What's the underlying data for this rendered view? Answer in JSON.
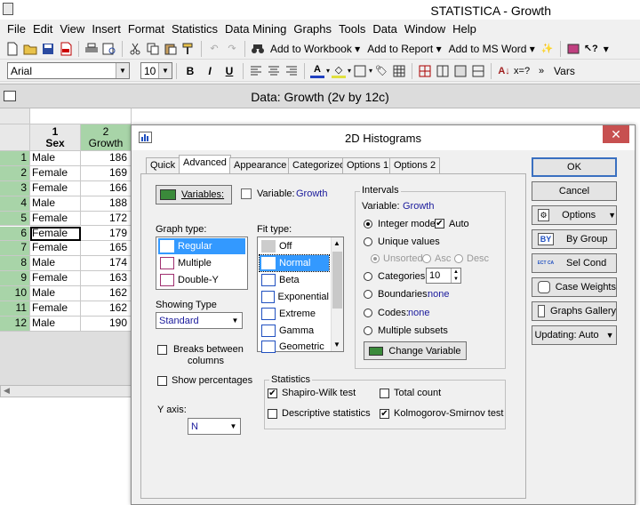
{
  "app": {
    "title": "STATISTICA - Growth"
  },
  "menu": [
    "File",
    "Edit",
    "View",
    "Insert",
    "Format",
    "Statistics",
    "Data Mining",
    "Graphs",
    "Tools",
    "Data",
    "Window",
    "Help"
  ],
  "toolbar1": {
    "add_workbook": "Add to Workbook",
    "add_report": "Add to Report",
    "add_msword": "Add to MS Word"
  },
  "toolbar2": {
    "font": "Arial",
    "size": "10",
    "bold": "B",
    "italic": "I",
    "underline": "U",
    "vars": "Vars"
  },
  "data_window": {
    "title": "Data: Growth (2v by 12c)"
  },
  "sheet": {
    "columns": [
      {
        "num": "1",
        "name": "Sex"
      },
      {
        "num": "2",
        "name": "Growth"
      }
    ],
    "rows": [
      {
        "n": "1",
        "sex": "Male",
        "growth": "186"
      },
      {
        "n": "2",
        "sex": "Female",
        "growth": "169"
      },
      {
        "n": "3",
        "sex": "Female",
        "growth": "166"
      },
      {
        "n": "4",
        "sex": "Male",
        "growth": "188"
      },
      {
        "n": "5",
        "sex": "Female",
        "growth": "172"
      },
      {
        "n": "6",
        "sex": "Female",
        "growth": "179"
      },
      {
        "n": "7",
        "sex": "Female",
        "growth": "165"
      },
      {
        "n": "8",
        "sex": "Male",
        "growth": "174"
      },
      {
        "n": "9",
        "sex": "Female",
        "growth": "163"
      },
      {
        "n": "10",
        "sex": "Male",
        "growth": "162"
      },
      {
        "n": "11",
        "sex": "Female",
        "growth": "162"
      },
      {
        "n": "12",
        "sex": "Male",
        "growth": "190"
      }
    ]
  },
  "dialog": {
    "title": "2D Histograms",
    "close": "✕",
    "tabs": [
      "Quick",
      "Advanced",
      "Appearance",
      "Categorized",
      "Options 1",
      "Options 2"
    ],
    "variables_button": "Variables:",
    "variable_label": "Variable:",
    "variable_value": "Growth",
    "graph_type_label": "Graph type:",
    "graph_types": [
      "Regular",
      "Multiple",
      "Double-Y"
    ],
    "fit_type_label": "Fit type:",
    "fit_types": [
      "Off",
      "Normal",
      "Beta",
      "Exponential",
      "Extreme",
      "Gamma",
      "Geometric"
    ],
    "showing_type_label": "Showing Type",
    "showing_type_value": "Standard",
    "breaks_label_1": "Breaks between",
    "breaks_label_2": "columns",
    "show_percentages": "Show percentages",
    "y_axis_label": "Y axis:",
    "y_axis_value": "N",
    "intervals": {
      "title": "Intervals",
      "variable_label": "Variable:",
      "variable_value": "Growth",
      "integer_mode": "Integer mode",
      "auto": "Auto",
      "unique_values": "Unique values",
      "unsorted": "Unsorted",
      "asc": "Asc",
      "desc": "Desc",
      "categories": "Categories:",
      "categories_value": "10",
      "boundaries": "Boundaries:",
      "boundaries_value": "none",
      "codes": "Codes:",
      "codes_value": "none",
      "multiple_subsets": "Multiple subsets",
      "change_variable": "Change Variable"
    },
    "statistics": {
      "title": "Statistics",
      "shapiro": "Shapiro-Wilk test",
      "total_count": "Total count",
      "descriptive": "Descriptive statistics",
      "kolmogorov": "Kolmogorov-Smirnov test"
    },
    "buttons": {
      "ok": "OK",
      "cancel": "Cancel",
      "options": "Options",
      "by_group": "By Group",
      "sel_cond": "Sel Cond",
      "case_weights": "Case Weights",
      "graphs_gallery": "Graphs Gallery",
      "updating": "Updating: Auto"
    },
    "icon_text": {
      "select_cases": "SELECT CASES"
    }
  }
}
